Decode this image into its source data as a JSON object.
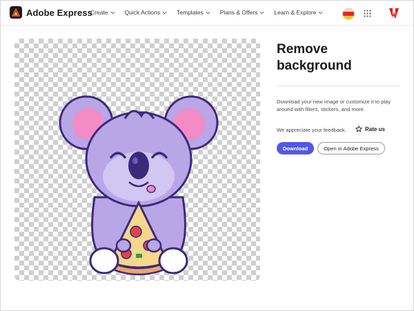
{
  "header": {
    "brand": "Adobe Express",
    "nav": [
      {
        "label": "Create"
      },
      {
        "label": "Quick Actions"
      },
      {
        "label": "Templates"
      },
      {
        "label": "Plans & Offers"
      },
      {
        "label": "Learn & Explore"
      }
    ],
    "icons": {
      "logo": "adobe-express-logo-icon",
      "apps": "apps-grid-icon",
      "adobe": "adobe-logo-icon",
      "avatar": "user-avatar"
    }
  },
  "main": {
    "image_alt": "koala-with-pizza-sticker",
    "title": "Remove background",
    "description": "Download your new image or customize it to play around with filters, stickers, and more.",
    "feedback_text": "We appreciate your feedback.",
    "rate_label": "Rate us",
    "download_label": "Download",
    "open_label": "Open in Adobe Express"
  },
  "colors": {
    "accent": "#5258e4",
    "koala_body": "#b8a6e6",
    "koala_ear_inner": "#f28bc6",
    "outline": "#3b2a78"
  }
}
